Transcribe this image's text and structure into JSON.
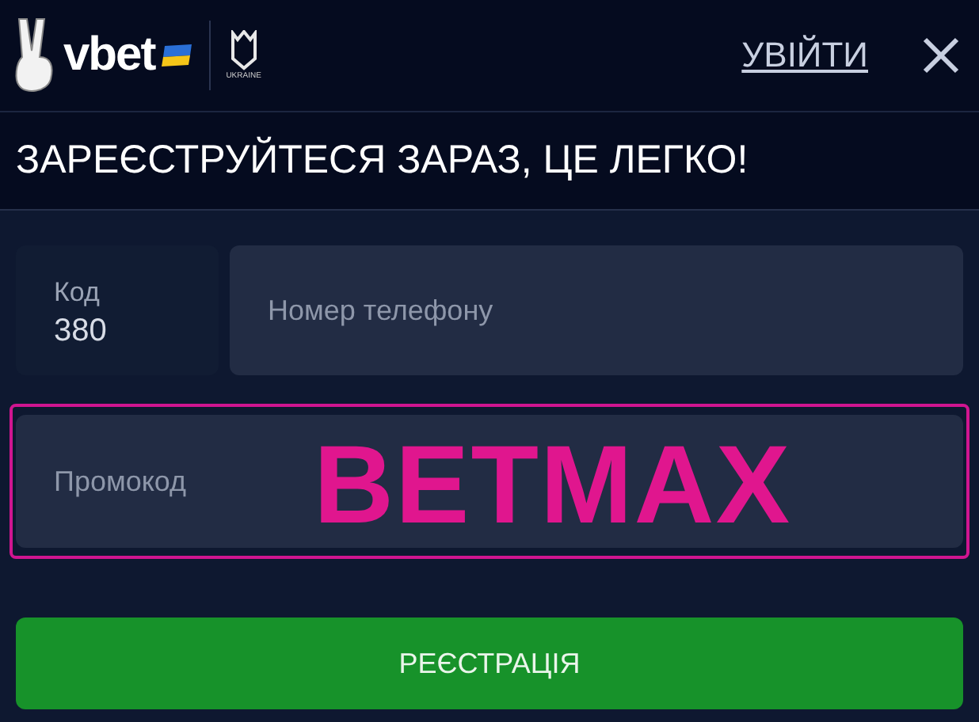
{
  "header": {
    "logo": "vbet",
    "emblem_caption": "UKRAINE",
    "login": "УВІЙТИ"
  },
  "title": "ЗАРЕЄСТРУЙТЕСЯ ЗАРАЗ, ЦЕ ЛЕГКО!",
  "code_field": {
    "label": "Код",
    "value": "380"
  },
  "phone_field": {
    "placeholder": "Номер телефону"
  },
  "promo_field": {
    "placeholder": "Промокод",
    "value": "BETMAX"
  },
  "register_button": "РЕЄСТРАЦІЯ"
}
